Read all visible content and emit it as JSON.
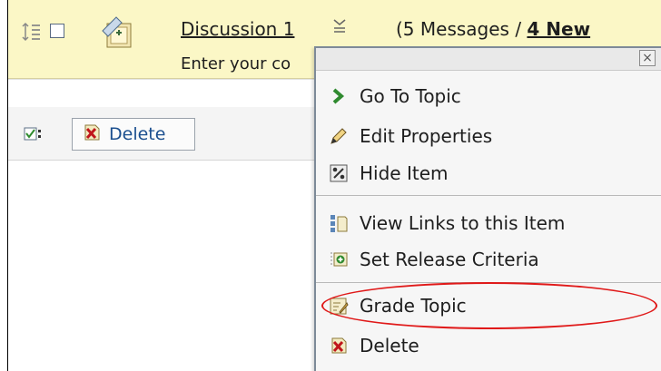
{
  "topic": {
    "title": "Discussion 1",
    "count_prefix": "(5 Messages / ",
    "new_label": "4 New",
    "description": "Enter your co",
    "icons": {
      "reorder": "reorder-icon",
      "topic": "discussion-topic-icon",
      "menu": "context-menu-icon"
    }
  },
  "toolbar": {
    "select_all_icon": "checkbox-selected-icon",
    "delete_label": "Delete",
    "delete_icon": "delete-icon"
  },
  "context_menu": {
    "close_label": "×",
    "items": [
      {
        "label": "Go To Topic",
        "icon": "chevron-right-icon"
      },
      {
        "label": "Edit Properties",
        "icon": "pencil-icon"
      },
      {
        "label": "Hide Item",
        "icon": "hide-icon"
      },
      {
        "label": "View Links to this Item",
        "icon": "links-icon"
      },
      {
        "label": "Set Release Criteria",
        "icon": "release-criteria-icon"
      },
      {
        "label": "Grade Topic",
        "icon": "grade-icon"
      },
      {
        "label": "Delete",
        "icon": "delete-icon"
      }
    ]
  },
  "colors": {
    "header_bg": "#fbf7c6",
    "highlight": "#e01919",
    "link": "#1b4f8f"
  }
}
